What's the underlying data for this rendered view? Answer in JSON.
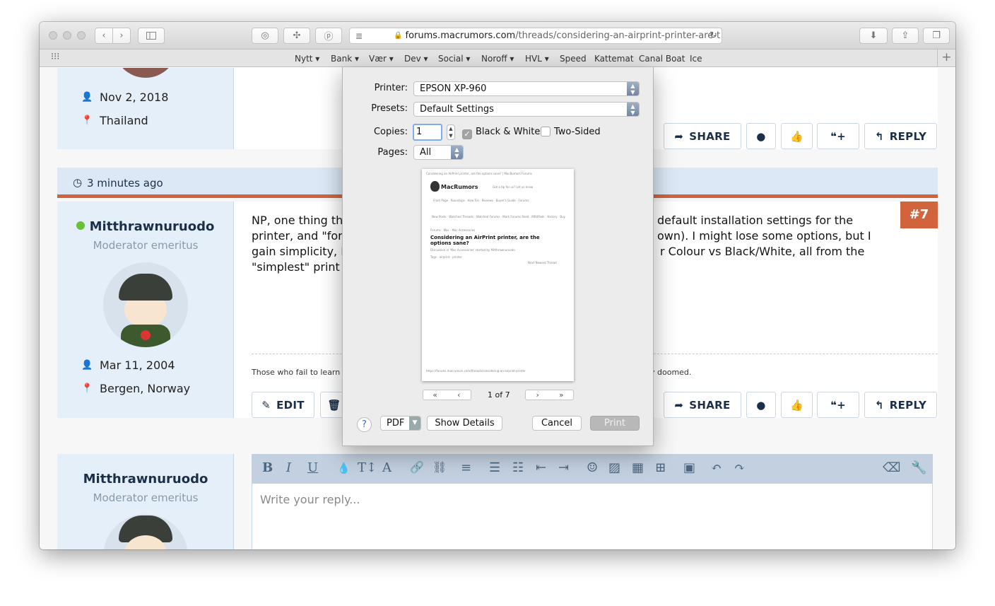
{
  "browser": {
    "url_host": "forums.macrumors.com",
    "url_path": "/threads/considering-an-airprint-printer-are-t",
    "icons": {
      "back": "chevron-left-icon",
      "forward": "chevron-right-icon",
      "sidebar": "sidebar-icon",
      "reload": "reload-icon"
    }
  },
  "bookmarks": [
    "Nytt ▾",
    "Bank ▾",
    "Vær ▾",
    "Dev ▾",
    "Social ▾",
    "Noroff ▾",
    "HVL ▾",
    "Speed",
    "Kattemat",
    "Canal Boat",
    "Ice"
  ],
  "prev_post": {
    "joined": "Nov 2, 2018",
    "location": "Thailand"
  },
  "post": {
    "timestamp": "3 minutes ago",
    "author": "Mitthrawnuruodo",
    "role": "Moderator emeritus",
    "number": "#7",
    "text_1": "NP, one thing th",
    "text_1b": "default installation settings for the",
    "text_2": "printer, and \"for",
    "text_2b": "own). I might lose some options, but I",
    "text_3": "gain simplicity, I",
    "text_3b": "r Colour vs Black/White, all from the",
    "text_4": "\"simplest\" print",
    "signature": "Those who fail to learn his",
    "signature_b": "y doomed.",
    "joined": "Mar 11, 2004",
    "location": "Bergen, Norway"
  },
  "actions": {
    "share": "SHARE",
    "reply": "REPLY",
    "quote": "❝+",
    "edit": "EDIT"
  },
  "reply_box": {
    "author": "Mitthrawnuruodo",
    "role": "Moderator emeritus",
    "placeholder": "Write your reply..."
  },
  "print_dialog": {
    "printer_label": "Printer:",
    "printer_value": "EPSON XP-960",
    "presets_label": "Presets:",
    "presets_value": "Default Settings",
    "copies_label": "Copies:",
    "copies_value": "1",
    "bw_label": "Black & White",
    "bw_checked": true,
    "two_sided_label": "Two-Sided",
    "two_sided_checked": false,
    "pages_label": "Pages:",
    "pages_value": "All",
    "page_indicator": "1 of 7",
    "help": "?",
    "pdf": "PDF",
    "show_details": "Show Details",
    "cancel": "Cancel",
    "print": "Print",
    "preview": {
      "title": "Considering an AirPrint printer, are the options sane?",
      "site": "MacRumors",
      "tagline": "Got a tip for us? Let us know"
    }
  }
}
